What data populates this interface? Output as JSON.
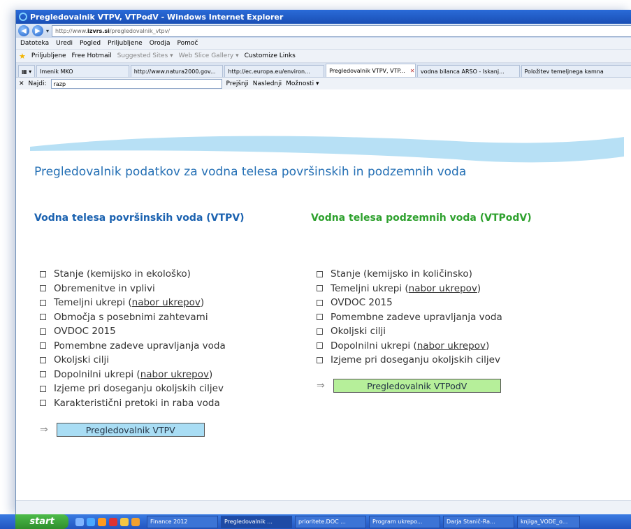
{
  "window": {
    "title": "Pregledovalnik VTPV, VTPodV - Windows Internet Explorer"
  },
  "address": {
    "prefix": "http://www.",
    "host": "izvrs.si",
    "path": "/pregledovalnik_vtpv/"
  },
  "menu": [
    "Datoteka",
    "Uredi",
    "Pogled",
    "Priljubljene",
    "Orodja",
    "Pomoč"
  ],
  "favorites": {
    "label": "Priljubljene",
    "items": [
      "Free Hotmail",
      "Suggested Sites ▾",
      "Web Slice Gallery ▾",
      "Customize Links"
    ]
  },
  "tabs": [
    {
      "label": "Imenik MKO"
    },
    {
      "label": "http://www.natura2000.gov..."
    },
    {
      "label": "http://ec.europa.eu/environ..."
    },
    {
      "label": "Pregledovalnik VTPV, VTP..."
    },
    {
      "label": "vodna bilanca ARSO - Iskanj..."
    },
    {
      "label": "Položitev temeljnega kamna"
    }
  ],
  "find": {
    "label": "Najdi:",
    "value": "razp",
    "prev": "Prejšnji",
    "next": "Naslednji",
    "options": "Možnosti ▾"
  },
  "page": {
    "heading": "Pregledovalnik podatkov za vodna telesa površinskih in podzemnih voda",
    "left": {
      "title": "Vodna telesa površinskih voda (VTPV)",
      "items": {
        "i0": "Stanje (kemijsko in ekološko)",
        "i1": "Obremenitve in vplivi",
        "i2a": "Temeljni ukrepi (",
        "i2b": "nabor ukrepov",
        "i2c": ")",
        "i3": "Območja s posebnimi zahtevami",
        "i4": "OVDOC 2015",
        "i5": "Pomembne zadeve upravljanja voda",
        "i6": "Okoljski cilji",
        "i7a": "Dopolnilni ukrepi (",
        "i7b": "nabor ukrepov",
        "i7c": ")",
        "i8": "Izjeme pri doseganju okoljskih ciljev",
        "i9": "Karakteristični pretoki in raba voda"
      },
      "button": "Pregledovalnik VTPV"
    },
    "right": {
      "title": "Vodna telesa podzemnih voda (VTPodV)",
      "items": {
        "i0": "Stanje (kemijsko in količinsko)",
        "i1a": "Temeljni ukrepi (",
        "i1b": "nabor ukrepov",
        "i1c": ")",
        "i2": "OVDOC 2015",
        "i3": "Pomembne zadeve upravljanja voda",
        "i4": "Okoljski cilji",
        "i5a": "Dopolnilni ukrepi (",
        "i5b": "nabor ukrepov",
        "i5c": ")",
        "i6": "Izjeme pri doseganju okoljskih ciljev"
      },
      "button": "Pregledovalnik VTPodV"
    },
    "arrow": "⇒"
  },
  "taskbar": {
    "start": "start",
    "tasks": [
      "Finance 2012",
      "Pregledovalnik ...",
      "prioritete.DOC ...",
      "Program ukrepo...",
      "Darja Stanič-Ra...",
      "knjiga_VODE_o..."
    ]
  }
}
